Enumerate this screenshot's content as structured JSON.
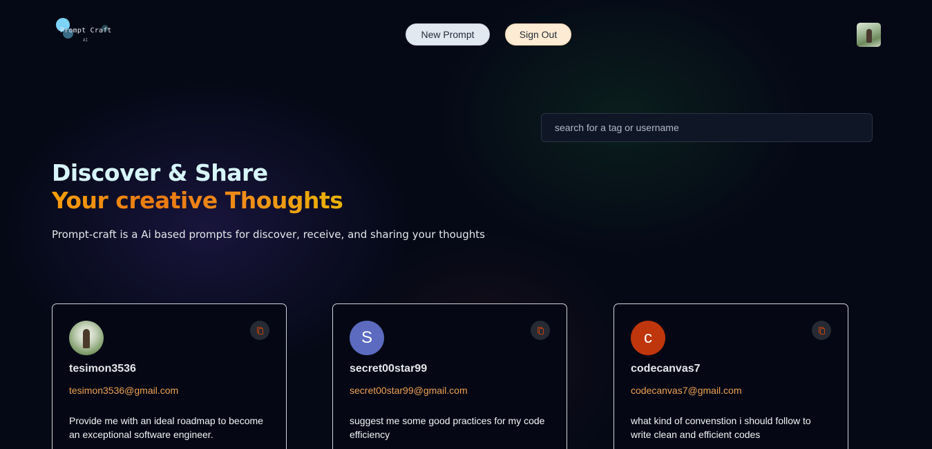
{
  "header": {
    "logo_text": "Prompt Craft",
    "logo_sub": "AI",
    "new_prompt_label": "New Prompt",
    "sign_out_label": "Sign Out"
  },
  "search": {
    "placeholder": "search for a tag or username",
    "value": ""
  },
  "hero": {
    "title_line1": "Discover & Share",
    "title_line2": "Your creative Thoughts",
    "description": "Prompt-craft is a Ai based prompts for discover, receive, and sharing your thoughts"
  },
  "prompts": [
    {
      "username": "tesimon3536",
      "email": "tesimon3536@gmail.com",
      "prompt": "Provide me with an ideal roadmap to become an exceptional software engineer.",
      "avatar_type": "photo"
    },
    {
      "username": "secret00star99",
      "email": "secret00star99@gmail.com",
      "prompt": "suggest me some good practices for my code efficiency",
      "avatar_letter": "S",
      "avatar_color": "#5c6bc0"
    },
    {
      "username": "codecanvas7",
      "email": "codecanvas7@gmail.com",
      "prompt": "what kind of convenstion i should follow to write clean and efficient codes",
      "avatar_letter": "c",
      "avatar_color": "#bf360c"
    }
  ],
  "colors": {
    "background": "#050916",
    "accent_orange": "#f08c1a",
    "email_color": "#eea052",
    "heading_light": "#d6f6fb"
  },
  "icons": {
    "copy": "copy-icon"
  }
}
